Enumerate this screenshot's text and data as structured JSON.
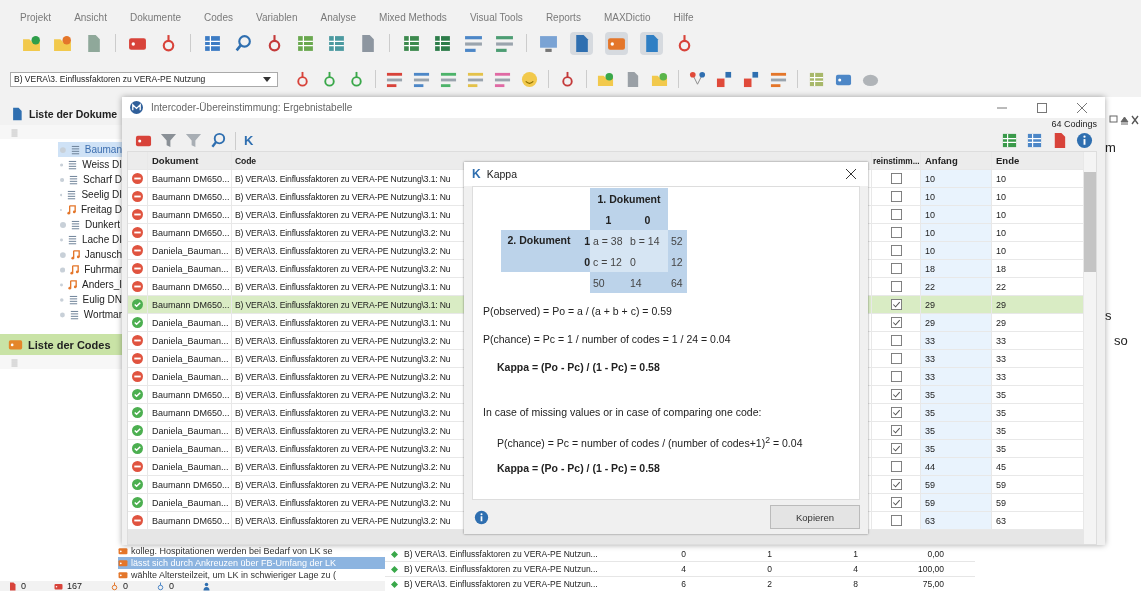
{
  "menu": [
    "Projekt",
    "Ansicht",
    "Dokumente",
    "Codes",
    "Variablen",
    "Analyse",
    "Mixed Methods",
    "Visual Tools",
    "Reports",
    "MAXDictio",
    "Hilfe"
  ],
  "code_selector": {
    "value": "B) VERA\\3. Einflussfaktoren zu VERA-PE Nutzung"
  },
  "documents_panel": {
    "title": "Liste der Dokume",
    "items": [
      {
        "label": "Bauman",
        "kind": "text",
        "selected": true
      },
      {
        "label": "Weiss DI",
        "kind": "text",
        "selected": false
      },
      {
        "label": "Scharf D",
        "kind": "text",
        "selected": false
      },
      {
        "label": "Seelig DI",
        "kind": "text",
        "selected": false
      },
      {
        "label": "Freitag D",
        "kind": "audio",
        "selected": false
      },
      {
        "label": "Dunkert",
        "kind": "text",
        "selected": false
      },
      {
        "label": "Lache DI",
        "kind": "text",
        "selected": false
      },
      {
        "label": "Janusch",
        "kind": "audio",
        "selected": false
      },
      {
        "label": "Fuhrmar",
        "kind": "audio",
        "selected": false
      },
      {
        "label": "Anders_I",
        "kind": "audio",
        "selected": false
      },
      {
        "label": "Eulig DN",
        "kind": "text",
        "selected": false
      },
      {
        "label": "Wortmar",
        "kind": "text",
        "selected": false
      }
    ]
  },
  "codes_panel": {
    "title": "Liste der Codes"
  },
  "segments": [
    {
      "text": "kolleg. Hospitationen werden bei Bedarf von LK se",
      "selected": false
    },
    {
      "text": "lässt sich durch Ankreuzen über FB-Umfang der LK",
      "selected": true
    },
    {
      "text": "wählte Altersteilzeit, um LK in schwieriger Lage zu (",
      "selected": false
    }
  ],
  "bottom_table": {
    "rows": [
      {
        "code": "B) VERA\\3. Einflussfaktoren zu VERA-PE Nutzun...",
        "values": [
          "0",
          "1",
          "1",
          "0,00"
        ]
      },
      {
        "code": "B) VERA\\3. Einflussfaktoren zu VERA-PE Nutzun...",
        "values": [
          "4",
          "0",
          "4",
          "100,00"
        ]
      },
      {
        "code": "B) VERA\\3. Einflussfaktoren zu VERA-PE Nutzun...",
        "values": [
          "6",
          "2",
          "8",
          "75,00"
        ]
      }
    ]
  },
  "right_fragments": [
    "m",
    "s",
    "so"
  ],
  "status_bar": [
    {
      "kind": "document",
      "count": "0"
    },
    {
      "kind": "segment",
      "count": "167"
    },
    {
      "kind": "memo",
      "count": "0"
    },
    {
      "kind": "link",
      "count": "0"
    }
  ],
  "result_window": {
    "title": "Intercoder-Übereinstimmung: Ergebnistabelle",
    "count": "64 Codings",
    "kappa_button": "K",
    "columns": [
      "Dokument",
      "Code",
      "reinstimm...",
      "Anfang",
      "Ende"
    ],
    "rows": [
      {
        "agree": false,
        "document": "Baumann DM650...",
        "code": "B) VERA\\3. Einflussfaktoren zu VERA-PE Nutzung\\3.1: Nu",
        "checked": false,
        "start": "10",
        "end": "10",
        "selected": false
      },
      {
        "agree": false,
        "document": "Baumann DM650...",
        "code": "B) VERA\\3. Einflussfaktoren zu VERA-PE Nutzung\\3.1: Nu",
        "checked": false,
        "start": "10",
        "end": "10",
        "selected": false
      },
      {
        "agree": false,
        "document": "Baumann DM650...",
        "code": "B) VERA\\3. Einflussfaktoren zu VERA-PE Nutzung\\3.1: Nu",
        "checked": false,
        "start": "10",
        "end": "10",
        "selected": false
      },
      {
        "agree": false,
        "document": "Baumann DM650...",
        "code": "B) VERA\\3. Einflussfaktoren zu VERA-PE Nutzung\\3.2: Nu",
        "checked": false,
        "start": "10",
        "end": "10",
        "selected": false
      },
      {
        "agree": false,
        "document": "Daniela_Bauman...",
        "code": "B) VERA\\3. Einflussfaktoren zu VERA-PE Nutzung\\3.2: Nu",
        "checked": false,
        "start": "10",
        "end": "10",
        "selected": false
      },
      {
        "agree": false,
        "document": "Daniela_Bauman...",
        "code": "B) VERA\\3. Einflussfaktoren zu VERA-PE Nutzung\\3.2: Nu",
        "checked": false,
        "start": "18",
        "end": "18",
        "selected": false
      },
      {
        "agree": false,
        "document": "Baumann DM650...",
        "code": "B) VERA\\3. Einflussfaktoren zu VERA-PE Nutzung\\3.1: Nu",
        "checked": false,
        "start": "22",
        "end": "22",
        "selected": false
      },
      {
        "agree": true,
        "document": "Baumann DM650...",
        "code": "B) VERA\\3. Einflussfaktoren zu VERA-PE Nutzung\\3.1: Nu",
        "checked": true,
        "start": "29",
        "end": "29",
        "selected": true
      },
      {
        "agree": true,
        "document": "Daniela_Bauman...",
        "code": "B) VERA\\3. Einflussfaktoren zu VERA-PE Nutzung\\3.1: Nu",
        "checked": true,
        "start": "29",
        "end": "29",
        "selected": false
      },
      {
        "agree": false,
        "document": "Daniela_Bauman...",
        "code": "B) VERA\\3. Einflussfaktoren zu VERA-PE Nutzung\\3.2: Nu",
        "checked": false,
        "start": "33",
        "end": "33",
        "selected": false
      },
      {
        "agree": false,
        "document": "Daniela_Bauman...",
        "code": "B) VERA\\3. Einflussfaktoren zu VERA-PE Nutzung\\3.2: Nu",
        "checked": false,
        "start": "33",
        "end": "33",
        "selected": false
      },
      {
        "agree": false,
        "document": "Daniela_Bauman...",
        "code": "B) VERA\\3. Einflussfaktoren zu VERA-PE Nutzung\\3.2: Nu",
        "checked": false,
        "start": "33",
        "end": "33",
        "selected": false
      },
      {
        "agree": true,
        "document": "Baumann DM650...",
        "code": "B) VERA\\3. Einflussfaktoren zu VERA-PE Nutzung\\3.2: Nu",
        "checked": true,
        "start": "35",
        "end": "35",
        "selected": false
      },
      {
        "agree": true,
        "document": "Baumann DM650...",
        "code": "B) VERA\\3. Einflussfaktoren zu VERA-PE Nutzung\\3.2: Nu",
        "checked": true,
        "start": "35",
        "end": "35",
        "selected": false
      },
      {
        "agree": true,
        "document": "Daniela_Bauman...",
        "code": "B) VERA\\3. Einflussfaktoren zu VERA-PE Nutzung\\3.2: Nu",
        "checked": true,
        "start": "35",
        "end": "35",
        "selected": false
      },
      {
        "agree": true,
        "document": "Daniela_Bauman...",
        "code": "B) VERA\\3. Einflussfaktoren zu VERA-PE Nutzung\\3.2: Nu",
        "checked": true,
        "start": "35",
        "end": "35",
        "selected": false
      },
      {
        "agree": false,
        "document": "Daniela_Bauman...",
        "code": "B) VERA\\3. Einflussfaktoren zu VERA-PE Nutzung\\3.2: Nu",
        "checked": false,
        "start": "44",
        "end": "45",
        "selected": false
      },
      {
        "agree": true,
        "document": "Baumann DM650...",
        "code": "B) VERA\\3. Einflussfaktoren zu VERA-PE Nutzung\\3.2: Nu",
        "checked": true,
        "start": "59",
        "end": "59",
        "selected": false
      },
      {
        "agree": true,
        "document": "Daniela_Bauman...",
        "code": "B) VERA\\3. Einflussfaktoren zu VERA-PE Nutzung\\3.2: Nu",
        "checked": true,
        "start": "59",
        "end": "59",
        "selected": false
      },
      {
        "agree": false,
        "document": "Baumann DM650...",
        "code": "B) VERA\\3. Einflussfaktoren zu VERA-PE Nutzung\\3.2: Nu",
        "checked": false,
        "start": "63",
        "end": "63",
        "selected": false
      }
    ]
  },
  "kappa": {
    "icon_letter": "K",
    "title": "Kappa",
    "matrix": {
      "col_header": "1. Dokument",
      "col_values": [
        "1",
        "0"
      ],
      "row_header": "2. Dokument",
      "rows": [
        {
          "value": "1",
          "cells": [
            "a = 38",
            "b = 14"
          ],
          "total": "52"
        },
        {
          "value": "0",
          "cells": [
            "c = 12",
            "0"
          ],
          "total": "12"
        }
      ],
      "totals": [
        "50",
        "14",
        "64"
      ]
    },
    "lines": [
      {
        "kind": "text",
        "text": "P(observed) = Po = a / (a + b + c) = 0.59"
      },
      {
        "kind": "text",
        "text": "P(chance) = Pc = 1 / number of codes = 1 / 24 = 0.04"
      },
      {
        "kind": "result",
        "text": "Kappa = (Po - Pc) / (1 - Pc) = 0.58"
      },
      {
        "kind": "heading",
        "text": "In case of missing values or in case of comparing one code:"
      },
      {
        "kind": "indent",
        "text": "P(chance) = Pc = number of codes / (number of codes+1)$^{2}$ = 0.04"
      },
      {
        "kind": "result",
        "text": "Kappa = (Po - Pc) / (1 - Pc) = 0.58"
      }
    ],
    "button": "Kopieren"
  }
}
